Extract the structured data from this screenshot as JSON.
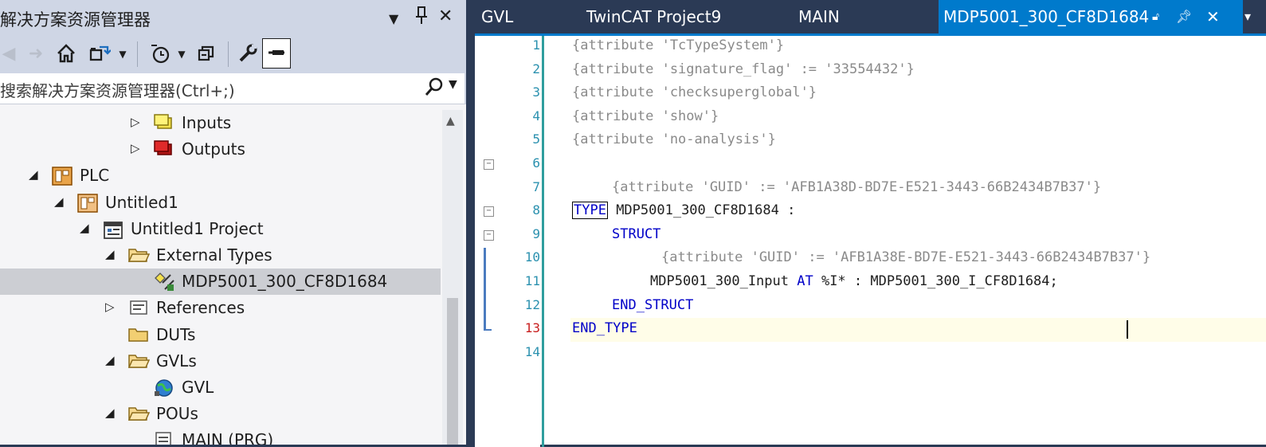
{
  "solution_explorer": {
    "title": "解决方案资源管理器",
    "search_placeholder": "搜索解决方案资源管理器(Ctrl+;)",
    "tree": [
      {
        "label": "Inputs",
        "depth": 5,
        "expander": "collapsed",
        "icon": "inputs-icon"
      },
      {
        "label": "Outputs",
        "depth": 5,
        "expander": "collapsed",
        "icon": "outputs-icon"
      },
      {
        "label": "PLC",
        "depth": 1,
        "expander": "expanded",
        "icon": "plc-icon"
      },
      {
        "label": "Untitled1",
        "depth": 2,
        "expander": "expanded",
        "icon": "plc-project-icon"
      },
      {
        "label": "Untitled1 Project",
        "depth": 3,
        "expander": "expanded",
        "icon": "project-icon"
      },
      {
        "label": "External Types",
        "depth": 4,
        "expander": "expanded",
        "icon": "folder-open-icon"
      },
      {
        "label": "MDP5001_300_CF8D1684",
        "depth": 5,
        "expander": "none",
        "icon": "type-icon",
        "selected": true
      },
      {
        "label": "References",
        "depth": 4,
        "expander": "collapsed",
        "icon": "references-icon"
      },
      {
        "label": "DUTs",
        "depth": 4,
        "expander": "none",
        "icon": "folder-icon"
      },
      {
        "label": "GVLs",
        "depth": 4,
        "expander": "expanded",
        "icon": "folder-open-icon"
      },
      {
        "label": "GVL",
        "depth": 5,
        "expander": "none",
        "icon": "gvl-icon"
      },
      {
        "label": "POUs",
        "depth": 4,
        "expander": "expanded",
        "icon": "folder-open-icon"
      },
      {
        "label": "MAIN (PRG)",
        "depth": 5,
        "expander": "none",
        "icon": "pou-icon"
      }
    ]
  },
  "tabs": [
    {
      "label": "GVL",
      "active": false
    },
    {
      "label": "TwinCAT Project9",
      "active": false
    },
    {
      "label": "MAIN",
      "active": false
    },
    {
      "label": "MDP5001_300_CF8D1684",
      "active": true
    }
  ],
  "editor": {
    "current_line": 13,
    "lines": [
      {
        "n": "1",
        "text": "{attribute 'TcTypeSystem'}"
      },
      {
        "n": "2",
        "text": "{attribute 'signature_flag' := '33554432'}"
      },
      {
        "n": "3",
        "text": "{attribute 'checksuperglobal'}"
      },
      {
        "n": "4",
        "text": "{attribute 'show'}"
      },
      {
        "n": "5",
        "text": "{attribute 'no-analysis'}"
      },
      {
        "n": "6",
        "text": ""
      },
      {
        "n": "7",
        "text": "{attribute 'GUID' := 'AFB1A38D-BD7E-E521-3443-66B2434B7B37'}"
      },
      {
        "n": "8",
        "kw": "TYPE",
        "text": " MDP5001_300_CF8D1684 :"
      },
      {
        "n": "9",
        "kw": "STRUCT",
        "text": ""
      },
      {
        "n": "10",
        "text": "{attribute 'GUID' := 'AFB1A38E-BD7E-E521-3443-66B2434B7B37'}"
      },
      {
        "n": "11",
        "pre": "MDP5001_300_Input ",
        "kw": "AT",
        "post": " %I* : MDP5001_300_I_CF8D1684;"
      },
      {
        "n": "12",
        "kw": "END_STRUCT",
        "text": ""
      },
      {
        "n": "13",
        "kw": "END_TYPE",
        "text": ""
      },
      {
        "n": "14",
        "text": ""
      }
    ]
  }
}
